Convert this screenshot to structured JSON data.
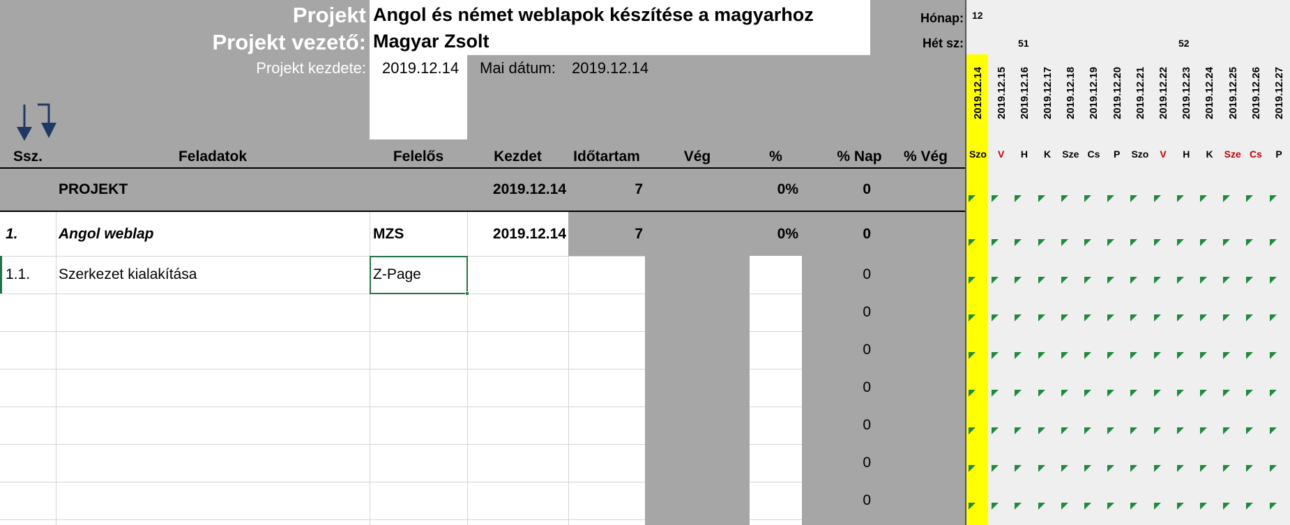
{
  "header": {
    "project_label": "Projekt",
    "project_name": "Angol és német weblapok készítése a magyarhoz",
    "manager_label": "Projekt vezető:",
    "manager_name": "Magyar Zsolt",
    "start_label": "Projekt kezdete:",
    "start_value": "2019.12.14",
    "today_label": "Mai dátum:",
    "today_value": "2019.12.14"
  },
  "calendar": {
    "month_label": "Hónap:",
    "month_value": "12",
    "week_label": "Hét sz:",
    "weeks": [
      "51",
      "52"
    ],
    "dates": [
      "2019.12.14",
      "2019.12.15",
      "2019.12.16",
      "2019.12.17",
      "2019.12.18",
      "2019.12.19",
      "2019.12.20",
      "2019.12.21",
      "2019.12.22",
      "2019.12.23",
      "2019.12.24",
      "2019.12.25",
      "2019.12.26",
      "2019.12.27"
    ],
    "days": [
      "Szo",
      "V",
      "H",
      "K",
      "Sze",
      "Cs",
      "P",
      "Szo",
      "V",
      "H",
      "K",
      "Sze",
      "Cs",
      "P"
    ],
    "day_colors": [
      "#000000",
      "#c00000",
      "#000000",
      "#000000",
      "#000000",
      "#000000",
      "#000000",
      "#000000",
      "#c00000",
      "#000000",
      "#000000",
      "#c00000",
      "#c00000",
      "#000000"
    ],
    "highlight_color": "#ffff00",
    "flag_color": "#1e8a3c"
  },
  "columns": {
    "ssz": "Ssz.",
    "tasks": "Feladatok",
    "owner": "Felelős",
    "start": "Kezdet",
    "duration": "Időtartam",
    "end": "Vég",
    "pct": "%",
    "pct_day": "% Nap",
    "pct_end": "% Vég"
  },
  "rows": {
    "project": {
      "name": "PROJEKT",
      "start": "2019.12.14",
      "duration": "7",
      "pct": "0%",
      "pct_day": "0"
    },
    "task1": {
      "ssz": "1.",
      "name": "Angol weblap",
      "owner": "MZS",
      "start": "2019.12.14",
      "duration": "7",
      "pct": "0%",
      "pct_day": "0"
    },
    "task11": {
      "ssz": "1.1.",
      "name": "Szerkezet kialakítása",
      "owner": "Z-Page",
      "pct_day": "0"
    },
    "empty_pct_day": [
      "0",
      "0",
      "0",
      "0",
      "0",
      "0"
    ]
  },
  "icons": [
    "sort-down-arrow-icon",
    "sort-step-arrow-icon"
  ],
  "colors": {
    "header_gray": "#a6a6a6",
    "arrow_blue": "#1f3864"
  }
}
